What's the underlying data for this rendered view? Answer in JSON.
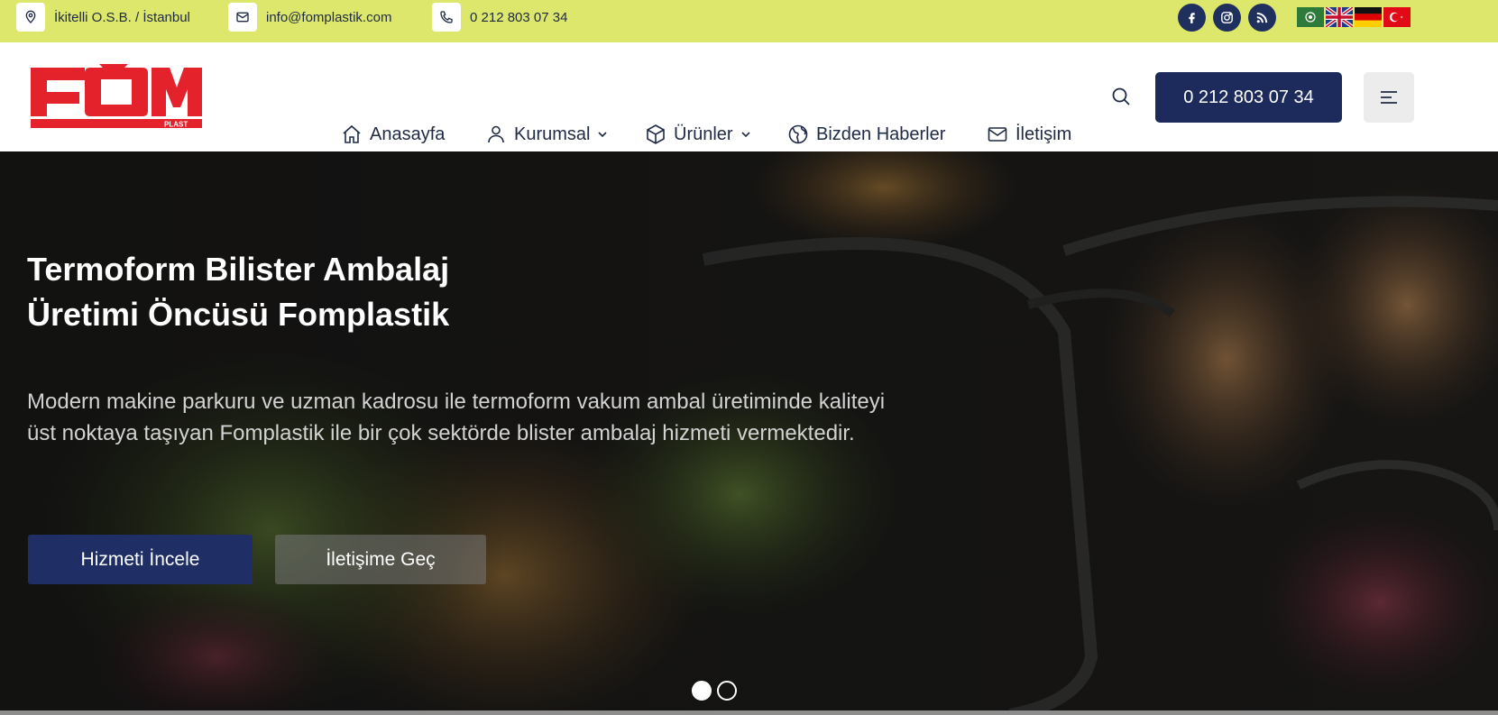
{
  "topbar": {
    "address": "İkitelli O.S.B. / İstanbul",
    "email": "info@fomplastik.com",
    "phone": "0 212 803 07 34",
    "socials": [
      "facebook-icon",
      "instagram-icon",
      "rss-icon"
    ],
    "languages": [
      "Arabic",
      "English",
      "German",
      "Turkish"
    ],
    "background_color": "#dde76b"
  },
  "header": {
    "logo": {
      "main": "FOM",
      "sub": "PLAST",
      "color": "#e4222b"
    },
    "nav": [
      {
        "label": "Anasayfa",
        "icon": "home-icon"
      },
      {
        "label": "Kurumsal",
        "icon": "user-icon",
        "dropdown": true
      },
      {
        "label": "Ürünler",
        "icon": "box-icon",
        "dropdown": true
      },
      {
        "label": "Bizden Haberler",
        "icon": "globe-icon"
      },
      {
        "label": "İletişim",
        "icon": "mail-icon"
      }
    ],
    "phone_button": "0 212 803 07 34",
    "accent_color": "#1c2b5c"
  },
  "hero": {
    "title_line1": "Termoform Bilister Ambalaj",
    "title_line2": "Üretimi Öncüsü Fomplastik",
    "description": "Modern makine parkuru ve uzman kadrosu ile termoform vakum ambal üretiminde kaliteyi üst noktaya taşıyan Fomplastik ile bir çok sektörde blister ambalaj hizmeti vermektedir.",
    "primary_button": "Hizmeti İncele",
    "secondary_button": "İletişime Geç",
    "slide_count": 2,
    "active_slide": 1
  }
}
